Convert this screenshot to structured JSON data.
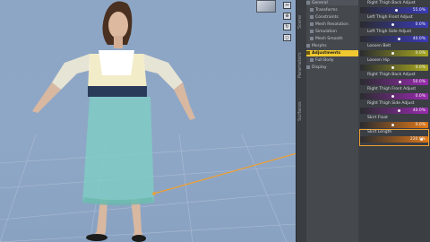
{
  "viewport": {
    "viewcube_label": "",
    "tools": [
      "↔",
      "⊕",
      "↻",
      "◻"
    ]
  },
  "left_tabs": [
    "Scene",
    "Parameters",
    "Surfaces"
  ],
  "scene_tree": {
    "items": [
      {
        "label": "General",
        "selected": false
      },
      {
        "label": "Transforms",
        "selected": false
      },
      {
        "label": "Constraints",
        "selected": false
      },
      {
        "label": "Mesh Resolution",
        "selected": false
      },
      {
        "label": "Simulation",
        "selected": false
      },
      {
        "label": "Mesh Smooth",
        "selected": false
      },
      {
        "label": "Morphs",
        "selected": false
      },
      {
        "label": "Adjustments",
        "selected": true
      },
      {
        "label": "Full Body",
        "selected": false
      },
      {
        "label": "Display",
        "selected": false
      }
    ]
  },
  "properties": [
    {
      "label": "Right Thigh Back Adjust",
      "value": "55.0%",
      "color": "#3a3ab8",
      "fraction": 0.55,
      "highlight": false
    },
    {
      "label": "Left Thigh Front Adjust",
      "value": "0.0%",
      "color": "#3a3ab8",
      "fraction": 0.5,
      "highlight": false
    },
    {
      "label": "Left Thigh Side Adjust",
      "value": "40.0%",
      "color": "#3a3ab8",
      "fraction": 0.6,
      "highlight": false
    },
    {
      "label": "Loosen Belt",
      "value": "0.0%",
      "color": "#a8a820",
      "fraction": 0.5,
      "highlight": false
    },
    {
      "label": "Loosen Hip",
      "value": "0.0%",
      "color": "#a8a820",
      "fraction": 0.5,
      "highlight": false
    },
    {
      "label": "Right Thigh Back Adjust",
      "value": "50.0%",
      "color": "#9a2ab0",
      "fraction": 0.62,
      "highlight": false
    },
    {
      "label": "Right Thigh Front Adjust",
      "value": "0.0%",
      "color": "#9a2ab0",
      "fraction": 0.5,
      "highlight": false
    },
    {
      "label": "Right Thigh Side Adjust",
      "value": "40.0%",
      "color": "#9a2ab0",
      "fraction": 0.6,
      "highlight": false
    },
    {
      "label": "Skirt Float",
      "value": "0.0%",
      "color": "#e07818",
      "fraction": 0.5,
      "highlight": false
    },
    {
      "label": "Skirt Length",
      "value": "220.0%",
      "color": "#e07818",
      "fraction": 0.95,
      "highlight": true
    }
  ],
  "accent_color": "#f0a030"
}
